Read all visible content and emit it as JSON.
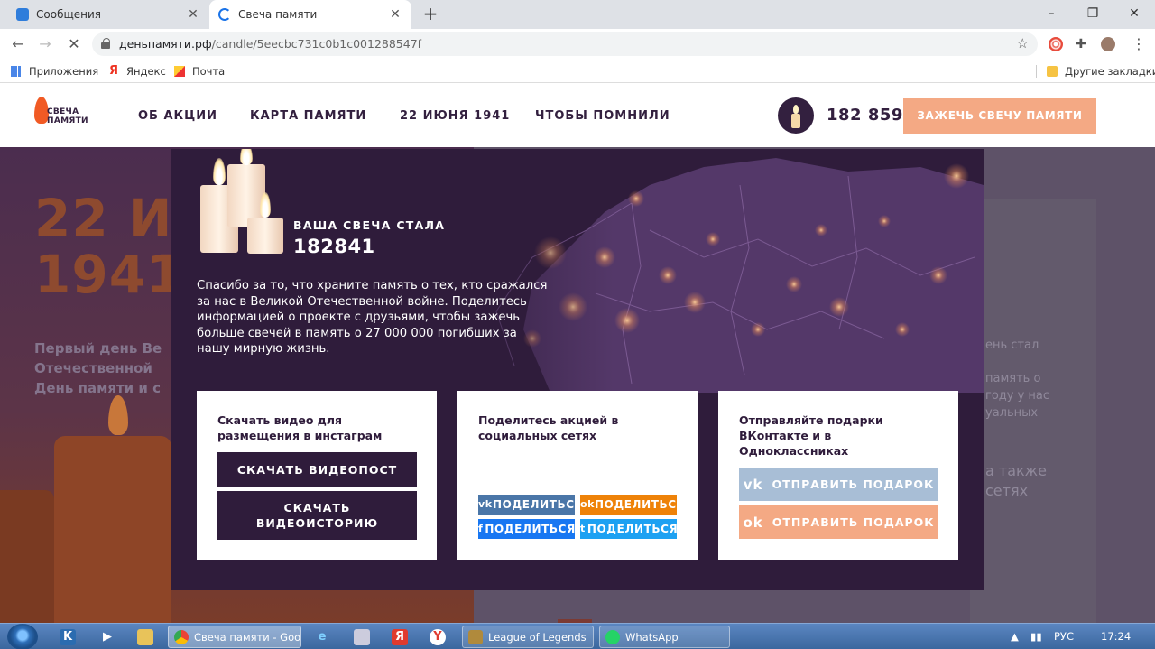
{
  "browser": {
    "tabs": [
      {
        "title": "Сообщения",
        "active": false
      },
      {
        "title": "Свеча памяти",
        "active": true
      }
    ],
    "url_host": "деньпамяти.рф",
    "url_path": "/candle/5eecbc731c0b1c001288547f",
    "bookmarks": [
      "Приложения",
      "Яндекс",
      "Почта"
    ],
    "other_bookmarks": "Другие закладки"
  },
  "site": {
    "logo_line1": "СВЕЧА",
    "logo_line2": "ПАМЯТИ",
    "nav": [
      "ОБ АКЦИИ",
      "КАРТА ПАМЯТИ",
      "22 ИЮНЯ 1941",
      "ЧТОБЫ ПОМНИЛИ"
    ],
    "counter": "182 859",
    "cta": "ЗАЖЕЧЬ СВЕЧУ ПАМЯТИ"
  },
  "background": {
    "hero_line1": "22 И",
    "hero_line2": "1941",
    "hero_sub": [
      "Первый день Ве",
      "Отечественной",
      "День памяти и с"
    ],
    "right_text": [
      "ень стал",
      "память о",
      "году у нас",
      "уальных"
    ],
    "right_text_big": [
      "а также",
      "сетях"
    ]
  },
  "modal": {
    "kicker": "ВАША СВЕЧА СТАЛА",
    "number": "182841",
    "text": "Спасибо за то, что храните память о тех, кто сражался за нас в Великой Отечественной войне. Поделитесь информацией о проекте с друзьями, чтобы зажечь больше свечей в память о 27 000 000 погибших за нашу мирную жизнь.",
    "card1": {
      "title": "Скачать видео для размещения в инстаграм",
      "btn_post": "СКАЧАТЬ ВИДЕОПОСТ",
      "btn_story": "СКАЧАТЬ ВИДЕОИСТОРИЮ"
    },
    "card2": {
      "title": "Поделитесь акцией в социальных сетях",
      "share_vk": "ПОДЕЛИТЬСЯ",
      "share_ok": "ПОДЕЛИТЬСЯ",
      "share_fb": "ПОДЕЛИТЬСЯ",
      "share_tw": "ПОДЕЛИТЬСЯ"
    },
    "card3": {
      "title": "Отправляйте подарки ВКонтакте и в Одноклассниках",
      "btn_vk": "ОТПРАВИТЬ ПОДАРОК",
      "btn_ok": "ОТПРАВИТЬ ПОДАРОК"
    }
  },
  "taskbar": {
    "buttons": [
      "Свеча памяти - Goo...",
      "League of Legends",
      "WhatsApp"
    ],
    "lang": "РУС",
    "time": "17:24"
  },
  "colors": {
    "brand_dark": "#2f1c3b",
    "accent_peach": "#f4a984",
    "vk_blue_light": "#a8bed6",
    "ok_orange": "#ee8208",
    "vk_blue": "#4a76a8",
    "fb_blue": "#1877f2",
    "tw_blue": "#1da1f2"
  }
}
